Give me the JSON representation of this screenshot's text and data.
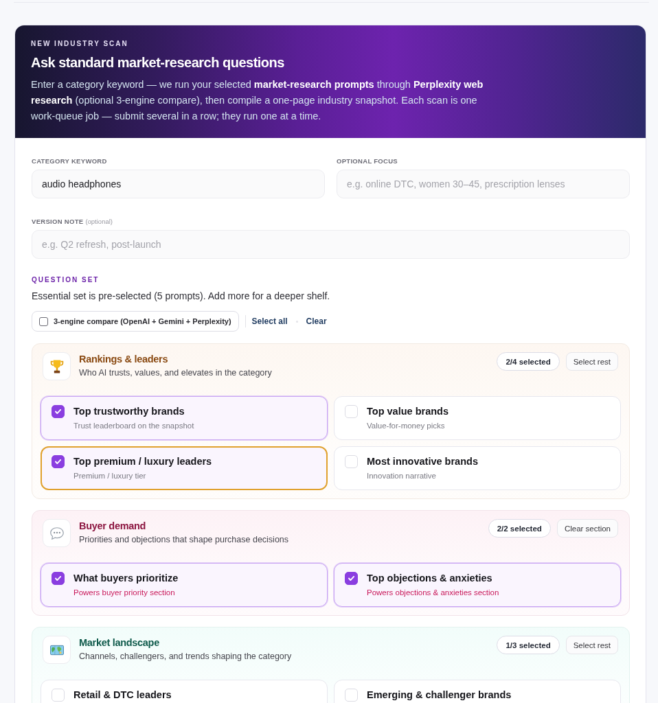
{
  "header": {
    "eyebrow": "NEW INDUSTRY SCAN",
    "title": "Ask standard market-research questions",
    "description": "Enter a category keyword — we run your selected **market-research prompts** through **Perplexity web research** (optional 3-engine compare), then compile a one-page industry snapshot. Each scan is one work-queue job — submit several in a row; they run one at a time."
  },
  "keyword_field": {
    "label": "CATEGORY KEYWORD",
    "value": "audio headphones"
  },
  "focus_field": {
    "label": "OPTIONAL FOCUS",
    "placeholder": "e.g. online DTC, women 30–45, prescription lenses"
  },
  "version_note_field": {
    "label": "VERSION NOTE",
    "hint": "(optional)",
    "placeholder": "e.g. Q2 refresh, post-launch"
  },
  "question_set": {
    "heading": "QUESTION SET",
    "description": "Essential set is pre-selected (5 prompts). Add more for a deeper shelf.",
    "compare_toggle": {
      "label": "3-engine compare (OpenAI + Gemini + Perplexity)",
      "checked": false
    },
    "actions": [
      "Select all",
      "Clear"
    ]
  },
  "sections": [
    {
      "title": "Rankings & leaders",
      "subtitle": "Who AI trusts, values, and elevates in the category",
      "color": "#8a4a12",
      "count": "2/4 selected",
      "action": "Select rest",
      "options": [
        {
          "title": "Top trustworthy brands",
          "note": "Trust leaderboard on the snapshot",
          "kind": "plain",
          "selected": true,
          "focused": false
        },
        {
          "title": "Top value brands",
          "note": "Value-for-money picks",
          "kind": "plain",
          "selected": false,
          "focused": false
        },
        {
          "title": "Top premium / luxury leaders",
          "note": "Premium / luxury tier",
          "kind": "plain",
          "selected": true,
          "focused": true
        },
        {
          "title": "Most innovative brands",
          "note": "Innovation narrative",
          "kind": "plain",
          "selected": false,
          "focused": false
        }
      ]
    },
    {
      "title": "Buyer demand",
      "subtitle": "Priorities and objections that shape purchase decisions",
      "color": "#8c1540",
      "count": "2/2 selected",
      "action": "Clear section",
      "options": [
        {
          "title": "What buyers prioritize",
          "note": "Powers buyer priority section",
          "kind": "accent",
          "selected": true,
          "focused": false
        },
        {
          "title": "Top objections & anxieties",
          "note": "Powers objections & anxieties section",
          "kind": "accent",
          "selected": true,
          "focused": false
        }
      ]
    },
    {
      "title": "Market landscape",
      "subtitle": "Channels, challengers, and trends shaping the category",
      "color": "#0f5a4b",
      "count": "1/3 selected",
      "action": "Select rest",
      "options": [
        {
          "title": "Retail & DTC leaders",
          "selected": false,
          "focused": false
        },
        {
          "title": "Emerging & challenger brands",
          "selected": false,
          "focused": false
        }
      ]
    }
  ]
}
